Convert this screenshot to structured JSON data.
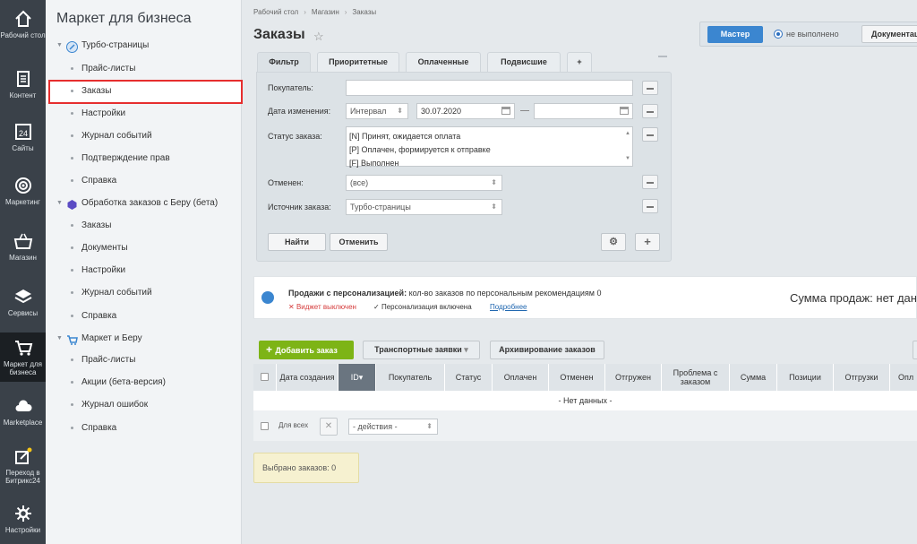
{
  "rail": [
    {
      "id": "desktop",
      "label": "Рабочий стол",
      "icon": "home-icon"
    },
    {
      "id": "content",
      "label": "Контент",
      "icon": "document-icon"
    },
    {
      "id": "sites",
      "label": "Сайты",
      "icon": "calendar-24-icon"
    },
    {
      "id": "marketing",
      "label": "Маркетинг",
      "icon": "target-icon"
    },
    {
      "id": "shop",
      "label": "Магазин",
      "icon": "basket-icon"
    },
    {
      "id": "services",
      "label": "Сервисы",
      "icon": "layers-icon"
    },
    {
      "id": "market",
      "label": "Маркет для бизнеса",
      "icon": "cart-icon"
    },
    {
      "id": "marketplace",
      "label": "Marketplace",
      "icon": "cloud-icon"
    },
    {
      "id": "b24",
      "label": "Переход в Битрикс24",
      "icon": "edit-star-icon"
    },
    {
      "id": "settings",
      "label": "Настройки",
      "icon": "gear-icon"
    }
  ],
  "menu": {
    "title": "Маркет для бизнеса",
    "items": [
      {
        "label": "Турбо-страницы",
        "level": 1
      },
      {
        "label": "Прайс-листы",
        "level": 2
      },
      {
        "label": "Заказы",
        "level": 2
      },
      {
        "label": "Настройки",
        "level": 2
      },
      {
        "label": "Журнал событий",
        "level": 2
      },
      {
        "label": "Подтверждение прав",
        "level": 2
      },
      {
        "label": "Справка",
        "level": 2
      },
      {
        "label": "Обработка заказов с Беру (бета)",
        "level": 1
      },
      {
        "label": "Заказы",
        "level": 2
      },
      {
        "label": "Документы",
        "level": 2
      },
      {
        "label": "Настройки",
        "level": 2
      },
      {
        "label": "Журнал событий",
        "level": 2
      },
      {
        "label": "Справка",
        "level": 2
      },
      {
        "label": "Маркет и Беру",
        "level": 1
      },
      {
        "label": "Прайс-листы",
        "level": 2
      },
      {
        "label": "Акции (бета-версия)",
        "level": 2
      },
      {
        "label": "Журнал ошибок",
        "level": 2
      },
      {
        "label": "Справка",
        "level": 2
      }
    ]
  },
  "breadcrumb": [
    "Рабочий стол",
    "Магазин",
    "Заказы"
  ],
  "page_title": "Заказы",
  "master": {
    "button": "Мастер",
    "status": "не выполнено",
    "doc": "Документация"
  },
  "tabs": [
    "Фильтр",
    "Приоритетные",
    "Оплаченные",
    "Подвисшие",
    "+"
  ],
  "filter": {
    "buyer_label": "Покупатель:",
    "buyer_value": "",
    "date_label": "Дата изменения:",
    "date_mode": "Интервал",
    "date_from": "30.07.2020",
    "date_to": "",
    "status_label": "Статус заказа:",
    "status_options": [
      "[N] Принят, ожидается оплата",
      "[P] Оплачен, формируется к отправке",
      "[F] Выполнен"
    ],
    "canceled_label": "Отменен:",
    "canceled_value": "(все)",
    "source_label": "Источник заказа:",
    "source_value": "Турбо-страницы",
    "find": "Найти",
    "cancel": "Отменить"
  },
  "notice": {
    "bold": "Продажи с персонализацией:",
    "text": " кол-во заказов по персональным рекомендациям 0",
    "widget": "Виджет выключен",
    "personalization": "Персонализация включена",
    "more": "Подробнее",
    "sum": "Сумма продаж: нет данных"
  },
  "toolbar": {
    "add": "Добавить заказ",
    "transport": "Транспортные заявки",
    "archive": "Архивирование заказов"
  },
  "grid": {
    "columns": [
      "Дата создания",
      "ID",
      "Покупатель",
      "Статус",
      "Оплачен",
      "Отменен",
      "Отгружен",
      "Проблема с заказом",
      "Сумма",
      "Позиции",
      "Отгрузки",
      "Опл"
    ],
    "empty": "- Нет данных -",
    "for_all": "Для всех",
    "actions": "- действия -"
  },
  "selected": "Выбрано заказов: 0",
  "colors": {
    "accent": "#3b86d0",
    "add": "#7db416",
    "highlight": "#e62e2e",
    "rail": "#3a4149"
  }
}
